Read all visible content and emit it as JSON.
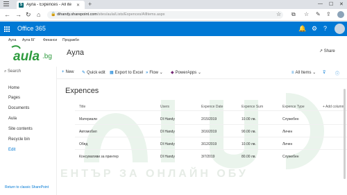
{
  "browser": {
    "tab_title": "Аула - Expences - All ite",
    "tab_favicon": "S",
    "url_host": "dihandy.sharepoint.com",
    "url_path": "/sites/aula/Lists/Expences/AllItems.aspx"
  },
  "suite": {
    "app_name": "Office 365"
  },
  "topnav": {
    "items": [
      "Аула",
      "Аула БГ",
      "Финанси",
      "Продажби"
    ]
  },
  "site": {
    "logo_text": "aula",
    "logo_suffix": ".bg",
    "title": "Аула",
    "share_label": "Share"
  },
  "leftnav": {
    "search_placeholder": "Search",
    "items": [
      "Home",
      "Pages",
      "Documents",
      "Aula",
      "Site contents",
      "Recycle bin",
      "Edit"
    ],
    "return_link": "Return to classic SharePoint"
  },
  "commandbar": {
    "new_label": "New",
    "quick_edit_label": "Quick edit",
    "export_label": "Export to Excel",
    "flow_label": "Flow",
    "powerapps_label": "PowerApps",
    "view_label": "All Items"
  },
  "list": {
    "title": "Expences",
    "columns": [
      "Title",
      "Users",
      "Expence Date",
      "Expence Sum",
      "Expence Type",
      "+ Add column"
    ],
    "rows": [
      [
        "Материали",
        "DI Handy",
        "2/15/2019",
        "10.00 лв.",
        "Служебен"
      ],
      [
        "Автомобил",
        "DI Handy",
        "3/16/2019",
        "90.00 лв.",
        "Личен"
      ],
      [
        "Обяд",
        "DI Handy",
        "3/12/2019",
        "10.00 лв.",
        "Личен"
      ],
      [
        "Консумативи за принтер",
        "DI Handy",
        "3/7/2019",
        "80.00 лв.",
        "Служебен"
      ]
    ],
    "watermark": "ЕНТЪР ЗА ОНЛАЙН ОБУ"
  },
  "colors": {
    "brand_blue": "#0078d4",
    "logo_green": "#2e9b3e"
  }
}
